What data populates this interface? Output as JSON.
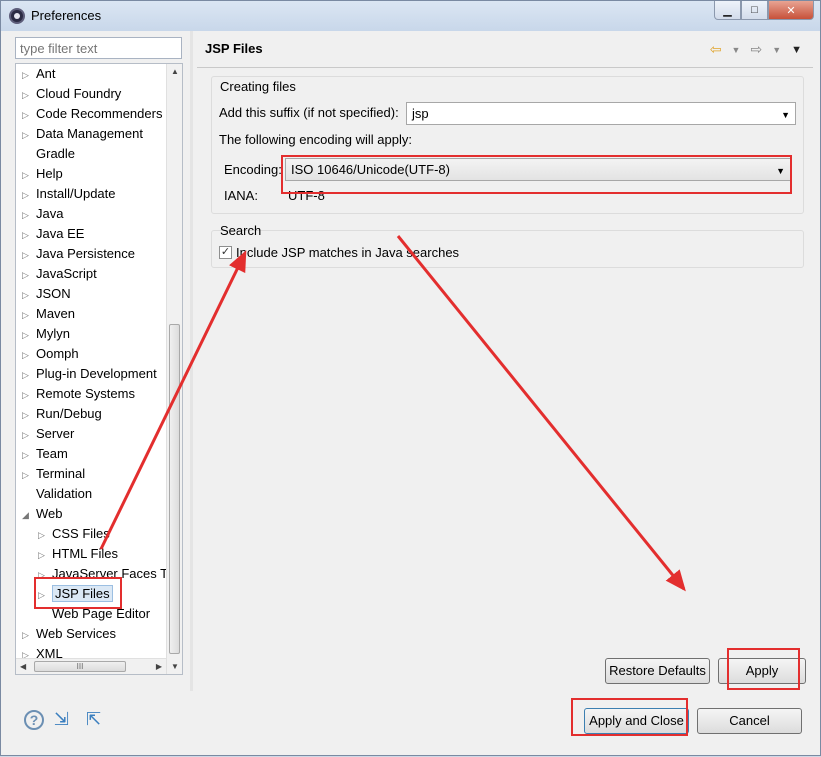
{
  "window": {
    "title": "Preferences"
  },
  "filter": {
    "placeholder": "type filter text"
  },
  "tree": [
    {
      "label": "Ant",
      "arrow": "▷",
      "indent": 0
    },
    {
      "label": "Cloud Foundry",
      "arrow": "▷",
      "indent": 0
    },
    {
      "label": "Code Recommenders",
      "arrow": "▷",
      "indent": 0
    },
    {
      "label": "Data Management",
      "arrow": "▷",
      "indent": 0
    },
    {
      "label": "Gradle",
      "arrow": "",
      "indent": 0
    },
    {
      "label": "Help",
      "arrow": "▷",
      "indent": 0
    },
    {
      "label": "Install/Update",
      "arrow": "▷",
      "indent": 0
    },
    {
      "label": "Java",
      "arrow": "▷",
      "indent": 0
    },
    {
      "label": "Java EE",
      "arrow": "▷",
      "indent": 0
    },
    {
      "label": "Java Persistence",
      "arrow": "▷",
      "indent": 0
    },
    {
      "label": "JavaScript",
      "arrow": "▷",
      "indent": 0
    },
    {
      "label": "JSON",
      "arrow": "▷",
      "indent": 0
    },
    {
      "label": "Maven",
      "arrow": "▷",
      "indent": 0
    },
    {
      "label": "Mylyn",
      "arrow": "▷",
      "indent": 0
    },
    {
      "label": "Oomph",
      "arrow": "▷",
      "indent": 0
    },
    {
      "label": "Plug-in Development",
      "arrow": "▷",
      "indent": 0
    },
    {
      "label": "Remote Systems",
      "arrow": "▷",
      "indent": 0
    },
    {
      "label": "Run/Debug",
      "arrow": "▷",
      "indent": 0
    },
    {
      "label": "Server",
      "arrow": "▷",
      "indent": 0
    },
    {
      "label": "Team",
      "arrow": "▷",
      "indent": 0
    },
    {
      "label": "Terminal",
      "arrow": "▷",
      "indent": 0
    },
    {
      "label": "Validation",
      "arrow": "",
      "indent": 0
    },
    {
      "label": "Web",
      "arrow": "◢",
      "indent": 0
    },
    {
      "label": "CSS Files",
      "arrow": "▷",
      "indent": 1
    },
    {
      "label": "HTML Files",
      "arrow": "▷",
      "indent": 1
    },
    {
      "label": "JavaServer Faces Tools",
      "arrow": "▷",
      "indent": 1
    },
    {
      "label": "JSP Files",
      "arrow": "▷",
      "indent": 1,
      "selected": true
    },
    {
      "label": "Web Page Editor",
      "arrow": "",
      "indent": 1
    },
    {
      "label": "Web Services",
      "arrow": "▷",
      "indent": 0
    },
    {
      "label": "XML",
      "arrow": "▷",
      "indent": 0
    }
  ],
  "page": {
    "title": "JSP Files",
    "creating_group": "Creating files",
    "suffix_label": "Add this suffix (if not specified):",
    "suffix_value": "jsp",
    "encoding_note": "The following encoding will apply:",
    "encoding_label": "Encoding:",
    "encoding_value": "ISO 10646/Unicode(UTF-8)",
    "iana_label": "IANA:",
    "iana_value": "UTF-8",
    "search_group": "Search",
    "include_label": "Include JSP matches in Java searches",
    "include_checked": true
  },
  "buttons": {
    "restore_defaults": "Restore Defaults",
    "apply": "Apply",
    "apply_and_close": "Apply and Close",
    "cancel": "Cancel"
  },
  "annotation_color": "#e32e2e"
}
